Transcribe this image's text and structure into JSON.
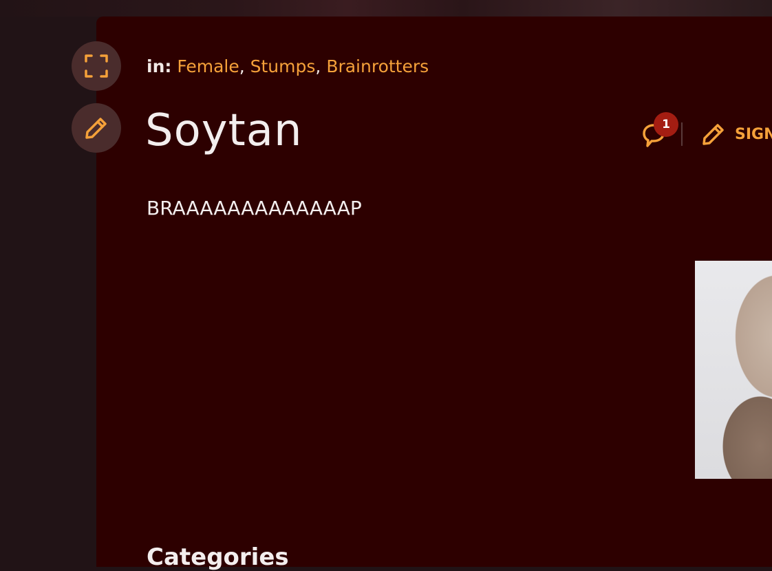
{
  "breadcrumb": {
    "prefix": "in:",
    "links": [
      "Female",
      "Stumps",
      "Brainrotters"
    ],
    "separator": ","
  },
  "page": {
    "title": "Soytan",
    "body": "BRAAAAAAAAAAAAAP",
    "section_heading": "Categories"
  },
  "actions": {
    "comment_count": "1",
    "sign_in_label": "SIGN"
  },
  "icons": {
    "fullscreen": "fullscreen-icon",
    "edit": "pencil-icon",
    "comments": "speech-bubble-icon",
    "sign_in": "pencil-icon"
  },
  "colors": {
    "accent": "#f5a13a",
    "panel": "#2d0000",
    "badge": "#a41d12",
    "page_bg": "#211316"
  }
}
